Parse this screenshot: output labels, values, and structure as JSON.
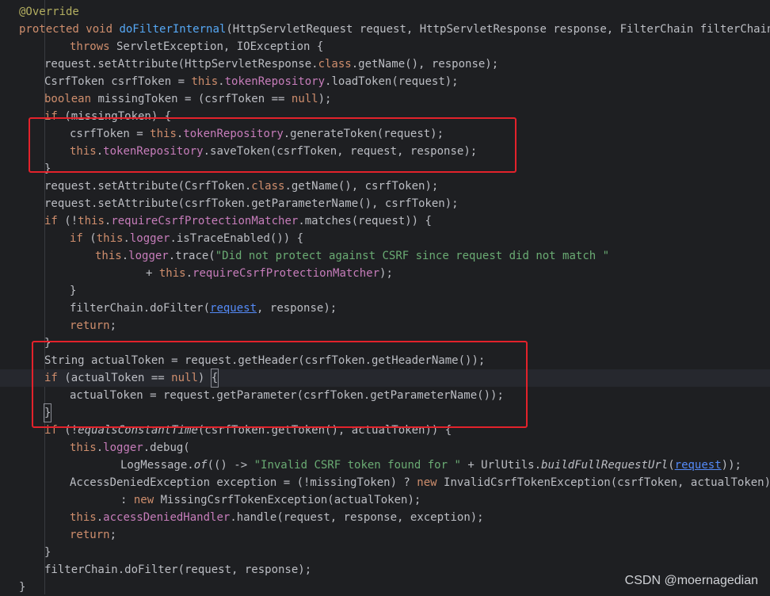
{
  "editor": {
    "watermark": "CSDN @moernagedian",
    "lines": [
      {
        "indent": 0,
        "tokens": [
          {
            "t": "@Override",
            "c": "annotation"
          }
        ]
      },
      {
        "indent": 0,
        "tokens": [
          {
            "t": "protected",
            "c": "kw"
          },
          {
            "t": " "
          },
          {
            "t": "void",
            "c": "kw"
          },
          {
            "t": " "
          },
          {
            "t": "doFilterInternal",
            "c": "fn"
          },
          {
            "t": "(HttpServletRequest request, HttpServletResponse response, FilterChain filterChain)"
          }
        ]
      },
      {
        "indent": 2,
        "tokens": [
          {
            "t": "throws",
            "c": "kw"
          },
          {
            "t": " ServletException, IOException {"
          }
        ]
      },
      {
        "indent": 1,
        "tokens": [
          {
            "t": "request.setAttribute(HttpServletResponse."
          },
          {
            "t": "class",
            "c": "kw"
          },
          {
            "t": ".getName(), response);"
          }
        ]
      },
      {
        "indent": 1,
        "tokens": [
          {
            "t": "CsrfToken csrfToken = "
          },
          {
            "t": "this",
            "c": "kw"
          },
          {
            "t": "."
          },
          {
            "t": "tokenRepository",
            "c": "field"
          },
          {
            "t": ".loadToken(request);"
          }
        ]
      },
      {
        "indent": 1,
        "tokens": [
          {
            "t": "boolean",
            "c": "kw"
          },
          {
            "t": " missingToken = (csrfToken == "
          },
          {
            "t": "null",
            "c": "kw"
          },
          {
            "t": ");"
          }
        ]
      },
      {
        "indent": 1,
        "tokens": [
          {
            "t": "if",
            "c": "kw"
          },
          {
            "t": " (missingToken) {"
          }
        ]
      },
      {
        "indent": 2,
        "tokens": [
          {
            "t": "csrfToken = "
          },
          {
            "t": "this",
            "c": "kw"
          },
          {
            "t": "."
          },
          {
            "t": "tokenRepository",
            "c": "field"
          },
          {
            "t": ".generateToken(request);"
          }
        ]
      },
      {
        "indent": 2,
        "tokens": [
          {
            "t": "this",
            "c": "kw"
          },
          {
            "t": "."
          },
          {
            "t": "tokenRepository",
            "c": "field"
          },
          {
            "t": ".saveToken(csrfToken, request, response);"
          }
        ]
      },
      {
        "indent": 1,
        "tokens": [
          {
            "t": "}"
          }
        ]
      },
      {
        "indent": 1,
        "tokens": [
          {
            "t": "request.setAttribute(CsrfToken."
          },
          {
            "t": "class",
            "c": "kw"
          },
          {
            "t": ".getName(), csrfToken);"
          }
        ]
      },
      {
        "indent": 1,
        "tokens": [
          {
            "t": "request.setAttribute(csrfToken.getParameterName(), csrfToken);"
          }
        ]
      },
      {
        "indent": 1,
        "tokens": [
          {
            "t": "if",
            "c": "kw"
          },
          {
            "t": " (!"
          },
          {
            "t": "this",
            "c": "kw"
          },
          {
            "t": "."
          },
          {
            "t": "requireCsrfProtectionMatcher",
            "c": "field"
          },
          {
            "t": ".matches(request)) {"
          }
        ]
      },
      {
        "indent": 2,
        "tokens": [
          {
            "t": "if",
            "c": "kw"
          },
          {
            "t": " ("
          },
          {
            "t": "this",
            "c": "kw"
          },
          {
            "t": "."
          },
          {
            "t": "logger",
            "c": "field"
          },
          {
            "t": ".isTraceEnabled()) {"
          }
        ]
      },
      {
        "indent": 3,
        "tokens": [
          {
            "t": "this",
            "c": "kw"
          },
          {
            "t": "."
          },
          {
            "t": "logger",
            "c": "field"
          },
          {
            "t": ".trace("
          },
          {
            "t": "\"Did not protect against CSRF since request did not match \"",
            "c": "str"
          }
        ]
      },
      {
        "indent": 5,
        "tokens": [
          {
            "t": "+ "
          },
          {
            "t": "this",
            "c": "kw"
          },
          {
            "t": "."
          },
          {
            "t": "requireCsrfProtectionMatcher",
            "c": "field"
          },
          {
            "t": ");"
          }
        ]
      },
      {
        "indent": 2,
        "tokens": [
          {
            "t": "}"
          }
        ]
      },
      {
        "indent": 2,
        "tokens": [
          {
            "t": "filterChain.doFilter("
          },
          {
            "t": "request",
            "c": "link"
          },
          {
            "t": ", response);"
          }
        ]
      },
      {
        "indent": 2,
        "tokens": [
          {
            "t": "return",
            "c": "kw"
          },
          {
            "t": ";"
          }
        ]
      },
      {
        "indent": 1,
        "tokens": [
          {
            "t": "}"
          }
        ]
      },
      {
        "indent": 1,
        "tokens": [
          {
            "t": "String actualToken = request.getHeader(csrfToken.getHeaderName());"
          }
        ]
      },
      {
        "indent": 1,
        "current": true,
        "tokens": [
          {
            "t": "if",
            "c": "kw"
          },
          {
            "t": " (actualToken == "
          },
          {
            "t": "null",
            "c": "kw"
          },
          {
            "t": ") "
          },
          {
            "t": "{",
            "c": "caret"
          }
        ]
      },
      {
        "indent": 2,
        "tokens": [
          {
            "t": "actualToken = request.getParameter(csrfToken.getParameterName());"
          }
        ]
      },
      {
        "indent": 1,
        "tokens": [
          {
            "t": "}",
            "c": "caret"
          }
        ]
      },
      {
        "indent": 1,
        "tokens": [
          {
            "t": "if",
            "c": "kw"
          },
          {
            "t": " (!"
          },
          {
            "t": "equalsConstantTime",
            "c": "ital"
          },
          {
            "t": "(csrfToken.getToken(), actualToken)) {"
          }
        ]
      },
      {
        "indent": 2,
        "tokens": [
          {
            "t": "this",
            "c": "kw"
          },
          {
            "t": "."
          },
          {
            "t": "logger",
            "c": "field"
          },
          {
            "t": ".debug("
          }
        ]
      },
      {
        "indent": 4,
        "tokens": [
          {
            "t": "LogMessage."
          },
          {
            "t": "of",
            "c": "ital"
          },
          {
            "t": "(() -> "
          },
          {
            "t": "\"Invalid CSRF token found for \"",
            "c": "str"
          },
          {
            "t": " + UrlUtils."
          },
          {
            "t": "buildFullRequestUrl",
            "c": "ital"
          },
          {
            "t": "("
          },
          {
            "t": "request",
            "c": "link"
          },
          {
            "t": "));"
          }
        ]
      },
      {
        "indent": 2,
        "tokens": [
          {
            "t": "AccessDeniedException exception = (!missingToken) ? "
          },
          {
            "t": "new",
            "c": "kw"
          },
          {
            "t": " InvalidCsrfTokenException(csrfToken, actualToken)"
          }
        ]
      },
      {
        "indent": 4,
        "tokens": [
          {
            "t": ": "
          },
          {
            "t": "new",
            "c": "kw"
          },
          {
            "t": " MissingCsrfTokenException(actualToken);"
          }
        ]
      },
      {
        "indent": 2,
        "tokens": [
          {
            "t": "this",
            "c": "kw"
          },
          {
            "t": "."
          },
          {
            "t": "accessDeniedHandler",
            "c": "field"
          },
          {
            "t": ".handle(request, response, exception);"
          }
        ]
      },
      {
        "indent": 2,
        "tokens": [
          {
            "t": "return",
            "c": "kw"
          },
          {
            "t": ";"
          }
        ]
      },
      {
        "indent": 1,
        "tokens": [
          {
            "t": "}"
          }
        ]
      },
      {
        "indent": 1,
        "tokens": [
          {
            "t": "filterChain.doFilter(request, response);"
          }
        ]
      },
      {
        "indent": 0,
        "tokens": [
          {
            "t": "}"
          }
        ]
      }
    ]
  }
}
